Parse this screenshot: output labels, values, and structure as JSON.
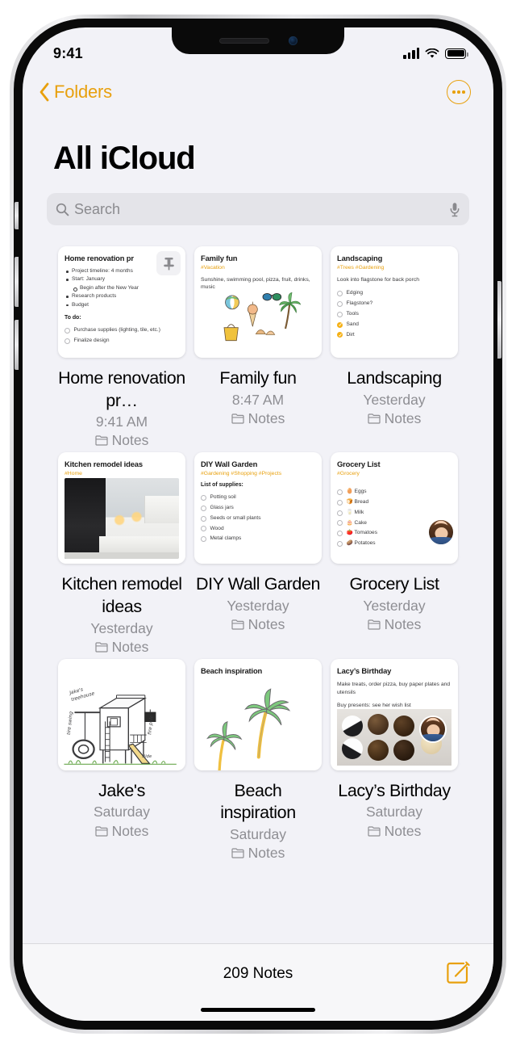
{
  "status_bar": {
    "time": "9:41",
    "signal_icon": "cellular-bars-icon",
    "wifi_icon": "wifi-icon",
    "battery_icon": "battery-full-icon"
  },
  "nav": {
    "back_label": "Folders",
    "back_icon": "chevron-left-icon",
    "more_icon": "ellipsis-circle-icon"
  },
  "header": {
    "title": "All iCloud"
  },
  "search": {
    "placeholder": "Search",
    "value": "",
    "search_icon": "search-icon",
    "mic_icon": "microphone-icon"
  },
  "notes": [
    {
      "title": "Home renovation pr…",
      "time": "9:41 AM",
      "folder": "Notes",
      "folder_icon": "folder-icon",
      "pinned": true,
      "pin_icon": "pin-icon",
      "preview": {
        "heading": "Home renovation pr",
        "tags": "",
        "bullets": [
          {
            "text": "Project timeline: 4 months",
            "level": 1
          },
          {
            "text": "Start: January",
            "level": 1
          },
          {
            "text": "Begin after the New Year",
            "level": 2
          },
          {
            "text": "Research products",
            "level": 1
          },
          {
            "text": "Budget",
            "level": 1
          }
        ],
        "subheading": "To do:",
        "checks": [
          {
            "label": "Purchase supplies (lighting, tile, etc.)",
            "done": false
          },
          {
            "label": "Finalize design",
            "done": false
          }
        ]
      }
    },
    {
      "title": "Family fun",
      "time": "8:47 AM",
      "folder": "Notes",
      "folder_icon": "folder-icon",
      "pinned": false,
      "preview": {
        "heading": "Family fun",
        "tags": "#Vacation",
        "body": "Sunshine, swimming pool, pizza, fruit, drinks, music",
        "drawing": "beach-doodles-sketch",
        "drawing_items": [
          "beach-ball",
          "ice-cream-cone",
          "sunglasses",
          "palm-tree",
          "beach-bag",
          "seashells"
        ]
      }
    },
    {
      "title": "Landscaping",
      "time": "Yesterday",
      "folder": "Notes",
      "folder_icon": "folder-icon",
      "pinned": false,
      "preview": {
        "heading": "Landscaping",
        "tags": "#Trees #Gardening",
        "body": "Look into flagstone for back porch",
        "checks": [
          {
            "label": "Edging",
            "done": false
          },
          {
            "label": "Flagstone?",
            "done": false
          },
          {
            "label": "Tools",
            "done": false
          },
          {
            "label": "Sand",
            "done": true
          },
          {
            "label": "Dirt",
            "done": true
          }
        ]
      }
    },
    {
      "title": "Kitchen remodel ideas",
      "time": "Yesterday",
      "folder": "Notes",
      "folder_icon": "folder-icon",
      "pinned": false,
      "preview": {
        "heading": "Kitchen remodel ideas",
        "tags": "#Home",
        "photo": "kitchen-interior-photo"
      }
    },
    {
      "title": "DIY Wall Garden",
      "time": "Yesterday",
      "folder": "Notes",
      "folder_icon": "folder-icon",
      "pinned": false,
      "preview": {
        "heading": "DIY Wall Garden",
        "tags": "#Gardening #Shopping #Projects",
        "subheading": "List of supplies:",
        "checks": [
          {
            "label": "Potting soil",
            "done": false
          },
          {
            "label": "Glass jars",
            "done": false
          },
          {
            "label": "Seeds or small plants",
            "done": false
          },
          {
            "label": "Wood",
            "done": false
          },
          {
            "label": "Metal clamps",
            "done": false
          }
        ]
      }
    },
    {
      "title": "Grocery List",
      "time": "Yesterday",
      "folder": "Notes",
      "folder_icon": "folder-icon",
      "pinned": false,
      "shared": true,
      "preview": {
        "heading": "Grocery List",
        "tags": "#Grocery",
        "checks": [
          {
            "label": "🥚 Eggs",
            "done": false
          },
          {
            "label": "🍞 Bread",
            "done": false
          },
          {
            "label": "🥛 Milk",
            "done": false
          },
          {
            "label": "🎂 Cake",
            "done": false
          },
          {
            "label": "🍅 Tomatoes",
            "done": false
          },
          {
            "label": "🥔 Potatoes",
            "done": false
          }
        ],
        "collaborator_avatar": "collaborator-avatar"
      }
    },
    {
      "title": "Jake's",
      "time": "Saturday",
      "folder": "Notes",
      "folder_icon": "folder-icon",
      "pinned": false,
      "preview": {
        "drawing": "treehouse-sketch",
        "sketch_labels": [
          "Jake's treehouse",
          "tire swing",
          "fire pole",
          "slide"
        ]
      }
    },
    {
      "title": "Beach inspiration",
      "time": "Saturday",
      "folder": "Notes",
      "folder_icon": "folder-icon",
      "pinned": false,
      "preview": {
        "heading": "Beach inspiration",
        "drawing": "palm-trees-sketch"
      }
    },
    {
      "title": "Lacy’s Birthday",
      "time": "Saturday",
      "folder": "Notes",
      "folder_icon": "folder-icon",
      "pinned": false,
      "shared": true,
      "preview": {
        "heading": "Lacy’s Birthday",
        "body": "Make treats, order pizza, buy paper plates and utensils",
        "body2": "Buy presents: see her wish list",
        "photo": "cake-pops-photo",
        "collaborator_avatar": "collaborator-avatar"
      }
    }
  ],
  "toolbar": {
    "count_label": "209 Notes",
    "compose_icon": "compose-note-icon"
  },
  "colors": {
    "accent": "#e8a00d",
    "check_done": "#f5b014",
    "background": "#f2f2f7",
    "card": "#ffffff",
    "secondary_text": "#8e8e93"
  }
}
